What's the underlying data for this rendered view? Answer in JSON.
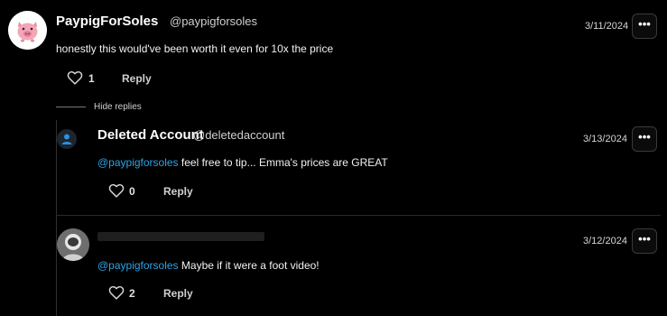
{
  "comments": [
    {
      "username": "PaypigForSoles",
      "handle": "@paypigforsoles",
      "date": "3/11/2024",
      "text": "honestly this would've been worth it even for 10x the price",
      "likes": "1",
      "reply_label": "Reply",
      "more_icon": "more-horizontal-icon",
      "avatar_icon": "pig-avatar-icon"
    }
  ],
  "hide_replies_label": "Hide replies",
  "replies": [
    {
      "username": "Deleted Account",
      "handle": "@deletedaccount",
      "date": "3/13/2024",
      "mention": "@paypigforsoles",
      "text": " feel free to tip... Emma's prices are GREAT",
      "likes": "0",
      "reply_label": "Reply"
    },
    {
      "username": "",
      "handle": "",
      "date": "3/12/2024",
      "mention": "@paypigforsoles",
      "text": " Maybe if it were a foot video!",
      "likes": "2",
      "reply_label": "Reply"
    }
  ],
  "colors": {
    "background": "#000000",
    "mention": "#2ea3e6",
    "avatar_pink": "#f3a6b8"
  }
}
